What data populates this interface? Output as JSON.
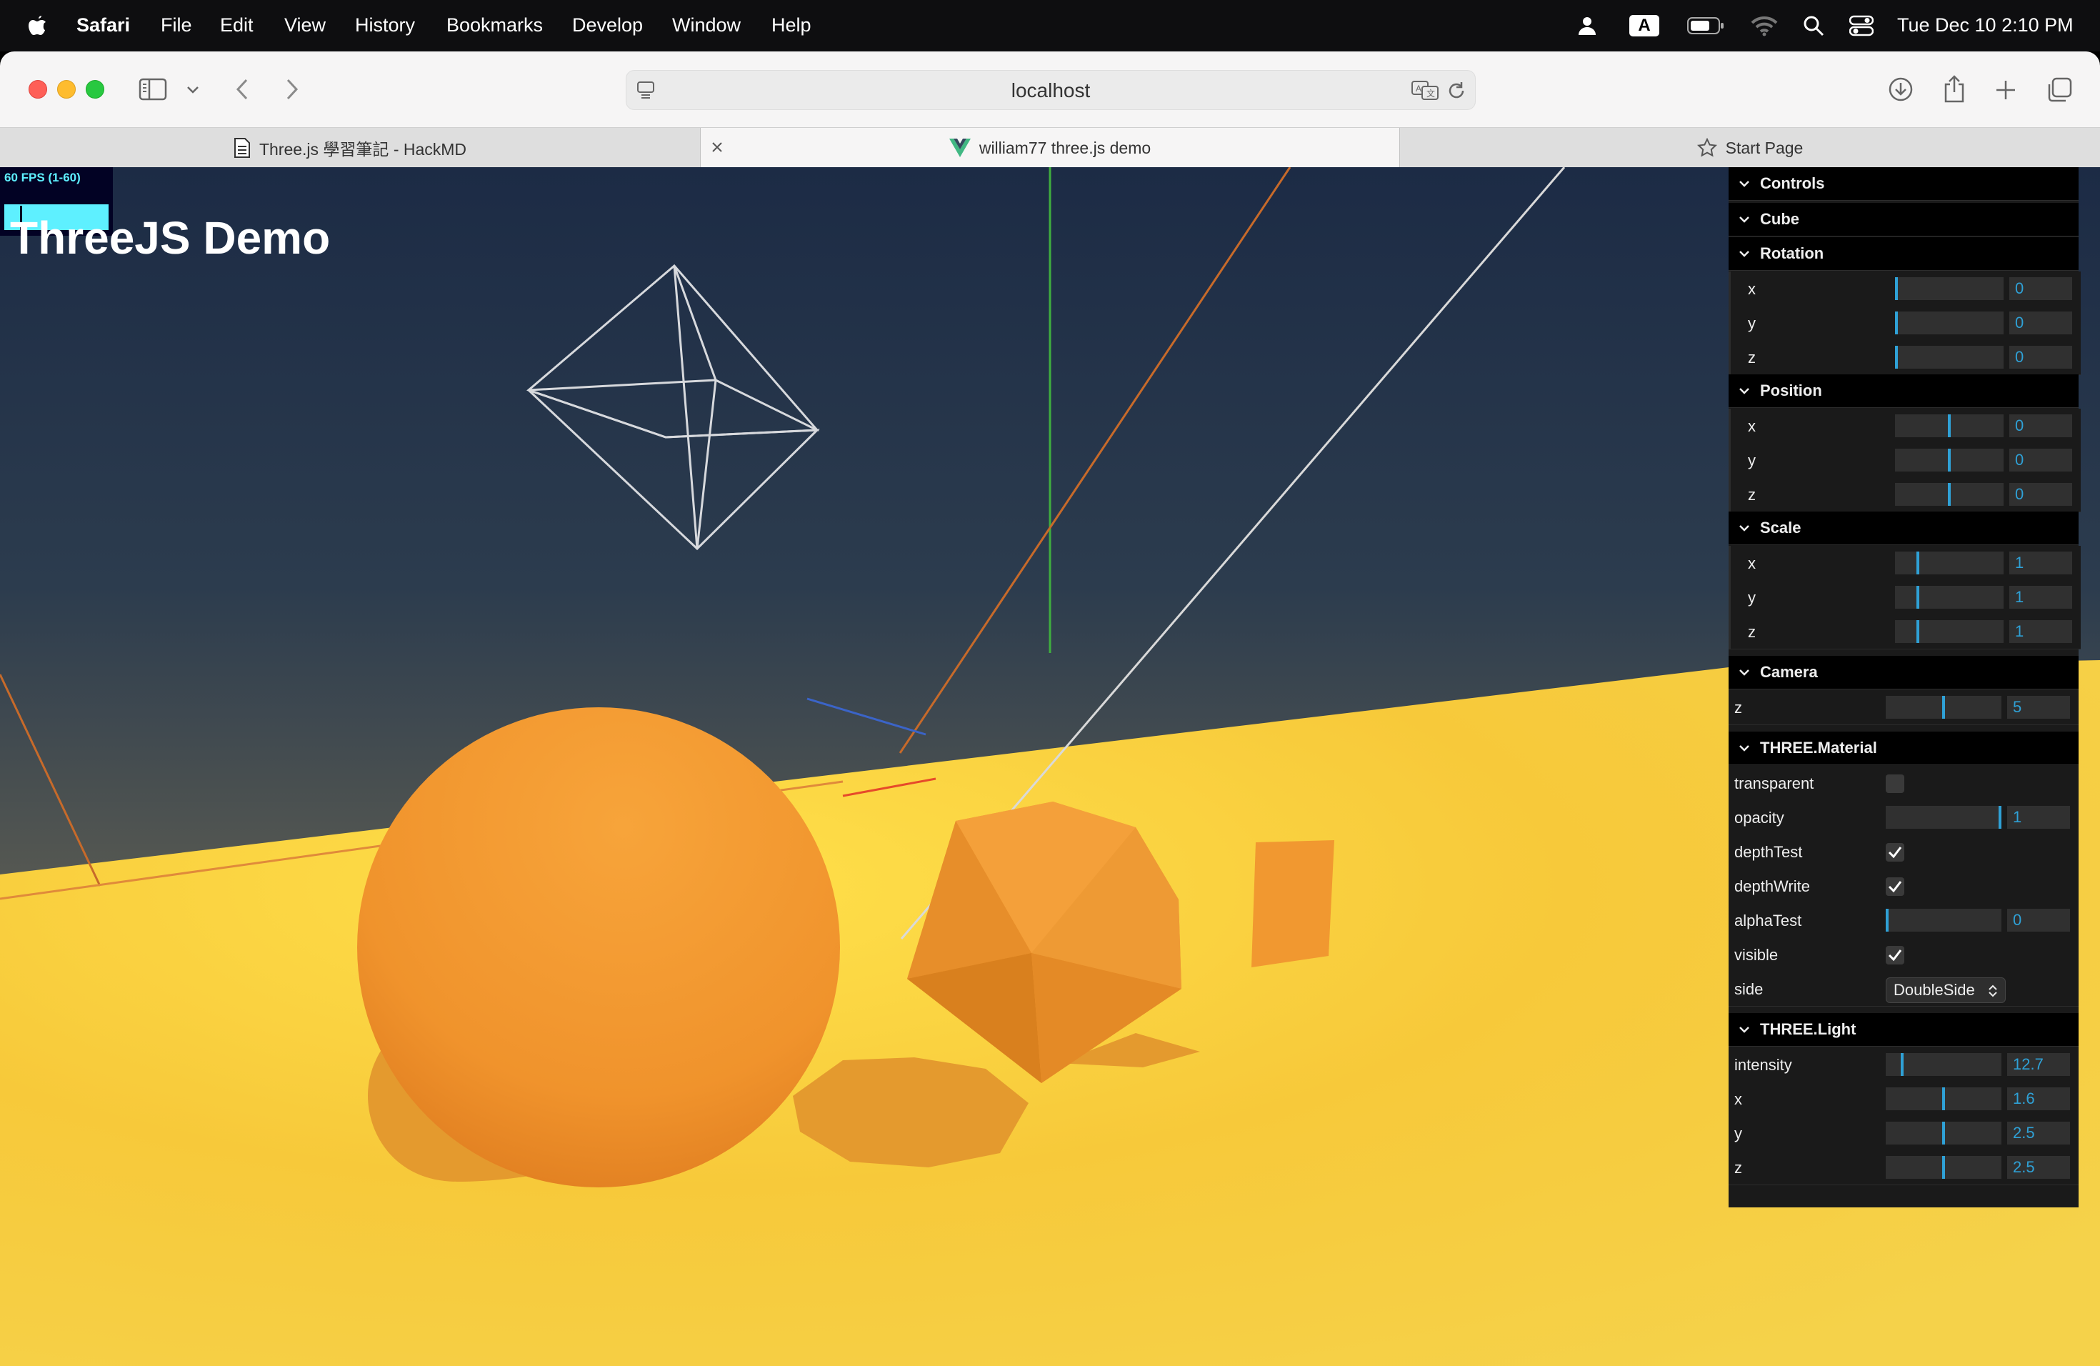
{
  "menubar": {
    "app": "Safari",
    "items": [
      "File",
      "Edit",
      "View",
      "History",
      "Bookmarks",
      "Develop",
      "Window",
      "Help"
    ],
    "input_source": "A",
    "clock": "Tue Dec 10  2:10 PM"
  },
  "browser": {
    "url": "localhost",
    "tabs": [
      {
        "label": "Three.js 學習筆記 - HackMD"
      },
      {
        "label": "william77 three.js demo"
      },
      {
        "label": "Start Page"
      }
    ]
  },
  "page": {
    "title": "ThreeJS Demo",
    "stats": "60 FPS (1-60)"
  },
  "gui": {
    "controls": "Controls",
    "cube": "Cube",
    "rotation": {
      "title": "Rotation",
      "x": "0",
      "y": "0",
      "z": "0",
      "fractions": [
        0,
        0,
        0
      ]
    },
    "position": {
      "title": "Position",
      "x": "0",
      "y": "0",
      "z": "0",
      "fractions": [
        0.5,
        0.5,
        0.5
      ]
    },
    "scale": {
      "title": "Scale",
      "x": "1",
      "y": "1",
      "z": "1",
      "fractions": [
        0.2,
        0.2,
        0.2
      ]
    },
    "camera": {
      "title": "Camera",
      "z": "5",
      "fraction": 0.5
    },
    "material": {
      "title": "THREE.Material",
      "transparent": {
        "label": "transparent",
        "checked": false
      },
      "opacity": {
        "label": "opacity",
        "value": "1",
        "fraction": 1.0
      },
      "depthTest": {
        "label": "depthTest",
        "checked": true
      },
      "depthWrite": {
        "label": "depthWrite",
        "checked": true
      },
      "alphaTest": {
        "label": "alphaTest",
        "value": "0",
        "fraction": 0
      },
      "visible": {
        "label": "visible",
        "checked": true
      },
      "side": {
        "label": "side",
        "value": "DoubleSide"
      }
    },
    "light": {
      "title": "THREE.Light",
      "intensity": {
        "label": "intensity",
        "value": "12.7",
        "fraction": 0.13
      },
      "x": {
        "label": "x",
        "value": "1.6",
        "fraction": 0.5
      },
      "y": {
        "label": "y",
        "value": "2.5",
        "fraction": 0.5
      },
      "z": {
        "label": "z",
        "value": "2.5",
        "fraction": 0.5
      }
    }
  },
  "colors": {
    "gui_accent": "#2fa1d6",
    "sky_top": "#1c2b45",
    "ground": "#f7c93a",
    "object": "#f39a2e",
    "stats_cyan": "#5ef0ff"
  }
}
